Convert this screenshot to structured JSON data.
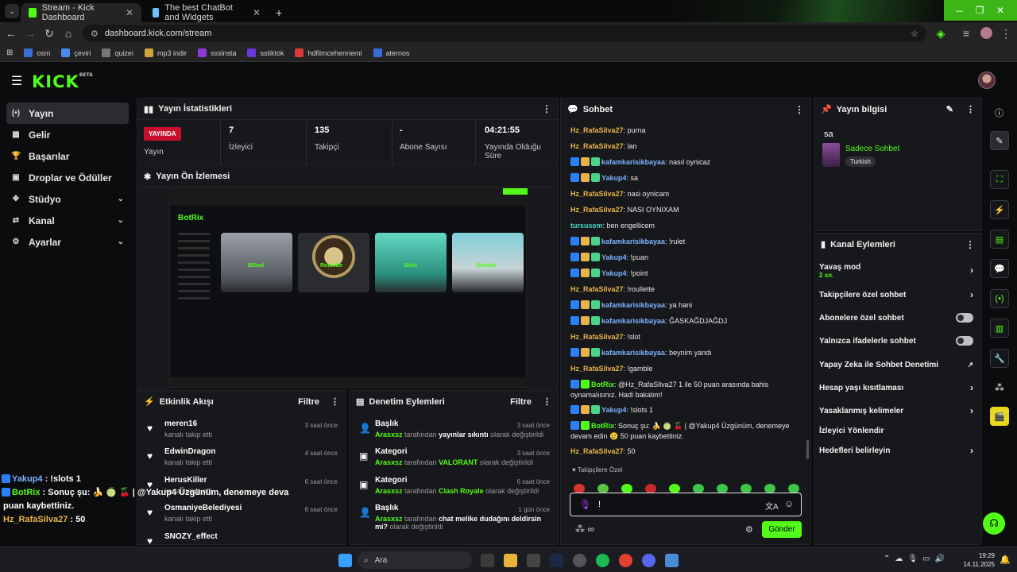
{
  "browser": {
    "tabs": [
      {
        "title": "Stream - Kick Dashboard",
        "active": true
      },
      {
        "title": "The best ChatBot and Widgets",
        "active": false
      }
    ],
    "url": "dashboard.kick.com/stream",
    "bookmarks": [
      "osm",
      "çeviri",
      "quizei",
      "mp3 indir",
      "sssinsta",
      "sstiktok",
      "hdfilmcehennemi",
      "aternos"
    ]
  },
  "brand": {
    "logo": "KICK",
    "beta": "BETA",
    "accent": "#53fc18",
    "live_color": "#c8102e"
  },
  "sidebar": {
    "items": [
      {
        "label": "Yayın",
        "icon": "broadcast-icon",
        "active": true
      },
      {
        "label": "Gelir",
        "icon": "revenue-icon"
      },
      {
        "label": "Başarılar",
        "icon": "trophy-icon"
      },
      {
        "label": "Droplar ve Ödüller",
        "icon": "gift-icon"
      },
      {
        "label": "Stüdyo",
        "icon": "studio-icon",
        "expandable": true
      },
      {
        "label": "Kanal",
        "icon": "channel-icon",
        "expandable": true
      },
      {
        "label": "Ayarlar",
        "icon": "gear-icon",
        "expandable": true
      }
    ]
  },
  "stats": {
    "title": "Yayın İstatistikleri",
    "live_badge": "YAYINDA",
    "items": [
      {
        "value": "",
        "label": "Yayın"
      },
      {
        "value": "7",
        "label": "İzleyici"
      },
      {
        "value": "135",
        "label": "Takipçi"
      },
      {
        "value": "-",
        "label": "Abone Sayısı"
      },
      {
        "value": "04:21:55",
        "label": "Yayında Olduğu Süre"
      }
    ]
  },
  "preview": {
    "title": "Yayın Ön İzlemesi",
    "app": "BotRix",
    "cards": [
      "BDuel",
      "Roulette",
      "Slots",
      "Gamble"
    ]
  },
  "activity": {
    "title": "Etkinlik Akışı",
    "filter": "Filtre",
    "items": [
      {
        "name": "meren16",
        "action": "kanalı takip etti",
        "time": "3 saat önce"
      },
      {
        "name": "EdwinDragon",
        "action": "kanalı takip etti",
        "time": "4 saat önce"
      },
      {
        "name": "HerusKiller",
        "action": "kanalı takip etti",
        "time": "6 saat önce"
      },
      {
        "name": "OsmaniyeBelediyesi",
        "action": "kanalı takip etti",
        "time": "6 saat önce"
      },
      {
        "name": "SNOZY_effect",
        "action": "",
        "time": ""
      }
    ]
  },
  "moderation": {
    "title": "Denetim Eylemleri",
    "filter": "Filtre",
    "items": [
      {
        "type": "Başlık",
        "by": "Arasxsz",
        "mid": "tarafından",
        "value": "yayınlar sıkıntı",
        "tail": "olarak değiştirildi",
        "time": "3 saat önce"
      },
      {
        "type": "Kategori",
        "by": "Arasxsz",
        "mid": "tarafından",
        "value": "VALORANT",
        "tail": "olarak değiştirildi",
        "time": "3 saat önce"
      },
      {
        "type": "Kategori",
        "by": "Arasxsz",
        "mid": "tarafından",
        "value": "Clash Royale",
        "tail": "olarak değiştirildi",
        "time": "6 saat önce"
      },
      {
        "type": "Başlık",
        "by": "Arasxsz",
        "mid": "tarafından",
        "value": "chat melike dudağını deldirsin mi?",
        "tail": "olarak değiştirildi",
        "time": "1 gün önce"
      }
    ]
  },
  "chat": {
    "title": "Sohbet",
    "messages": [
      {
        "user": "Hz_RafaSilva27",
        "color": "#e8b34a",
        "badges": 0,
        "text": ": purna"
      },
      {
        "user": "Hz_RafaSilva27",
        "color": "#e8b34a",
        "badges": 0,
        "text": ": lan"
      },
      {
        "user": "kafamkarisikbayaa",
        "color": "#7db2ff",
        "badges": 3,
        "text": ": nasıl oynicaz"
      },
      {
        "user": "Yakup4",
        "color": "#7db2ff",
        "badges": 3,
        "text": ": sa"
      },
      {
        "user": "Hz_RafaSilva27",
        "color": "#e8b34a",
        "badges": 0,
        "text": ": nasi oynicam"
      },
      {
        "user": "Hz_RafaSilva27",
        "color": "#e8b34a",
        "badges": 0,
        "text": ": NASI OYNIXAM"
      },
      {
        "user": "tursusem",
        "color": "#4ad3c8",
        "badges": 0,
        "text": ": ben engellicem"
      },
      {
        "user": "kafamkarisikbayaa",
        "color": "#7db2ff",
        "badges": 3,
        "text": ": !rulet"
      },
      {
        "user": "Yakup4",
        "color": "#7db2ff",
        "badges": 3,
        "text": ": !puan"
      },
      {
        "user": "Yakup4",
        "color": "#7db2ff",
        "badges": 3,
        "text": ": !point"
      },
      {
        "user": "Hz_RafaSilva27",
        "color": "#e8b34a",
        "badges": 0,
        "text": ": !roullette"
      },
      {
        "user": "kafamkarisikbayaa",
        "color": "#7db2ff",
        "badges": 3,
        "text": ": ya hani"
      },
      {
        "user": "kafamkarisikbayaa",
        "color": "#7db2ff",
        "badges": 3,
        "text": ": ĞASKAĞDJAĞDJ"
      },
      {
        "user": "Hz_RafaSilva27",
        "color": "#e8b34a",
        "badges": 0,
        "text": ": !slot"
      },
      {
        "user": "kafamkarisikbayaa",
        "color": "#7db2ff",
        "badges": 3,
        "text": ": beynim yandı"
      },
      {
        "user": "Hz_RafaSilva27",
        "color": "#e8b34a",
        "badges": 0,
        "text": ": !gamble"
      },
      {
        "user": "BotRix",
        "color": "#53fc18",
        "badges": 2,
        "text": ": @Hz_RafaSilva27 1 ile 50 puan arasında bahis oynamalısınız. Hadi bakalım!"
      },
      {
        "user": "Yakup4",
        "color": "#7db2ff",
        "badges": 3,
        "text": ": !slots 1"
      },
      {
        "user": "BotRix",
        "color": "#53fc18",
        "badges": 2,
        "text": ": Sonuç şu: 🍌 🍈 🍒 | @Yakup4 Üzgünüm, denemeye devam edin 😢 50 puan kaybettiniz."
      },
      {
        "user": "Hz_RafaSilva27",
        "color": "#e8b34a",
        "badges": 0,
        "text": ": 50"
      }
    ],
    "followers_only": "Takipçilere Özel",
    "input_value": "!",
    "send": "Gönder"
  },
  "stream_info": {
    "title": "Yayın bilgisi",
    "stream_title": "sa",
    "category": "Sadece Sohbet",
    "language": "Turkish"
  },
  "channel_actions": {
    "title": "Kanal Eylemleri",
    "items": [
      {
        "label": "Yavaş mod",
        "sub": "2 sn.",
        "control": "arrow"
      },
      {
        "label": "Takipçilere özel sohbet",
        "control": "arrow"
      },
      {
        "label": "Abonelere özel sohbet",
        "control": "toggle"
      },
      {
        "label": "Yalnızca ifadelerle sohbet",
        "control": "toggle"
      },
      {
        "label": "Yapay Zeka ile Sohbet Denetimi",
        "control": "external"
      },
      {
        "label": "Hesap yaşı kısıtlaması",
        "control": "arrow"
      },
      {
        "label": "Yasaklanmış kelimeler",
        "control": "arrow"
      },
      {
        "label": "İzleyici Yönlendir",
        "control": "none"
      },
      {
        "label": "Hedefleri belirleyin",
        "control": "arrow"
      }
    ]
  },
  "overlay": {
    "lines": [
      {
        "user": "Yakup4",
        "text": " : !slots 1"
      },
      {
        "user": "BotRix",
        "text": " : Sonuç şu: 🍌 🍈 🍒 | @Yakup4 Üzgünüm, denemeye deva"
      },
      {
        "user": "",
        "text": "puan kaybettiniz."
      },
      {
        "user": "Hz_RafaSilva27",
        "text": " : 50"
      }
    ]
  },
  "taskbar": {
    "search": "Ara",
    "time": "19:29",
    "date": "14.11.2025"
  }
}
